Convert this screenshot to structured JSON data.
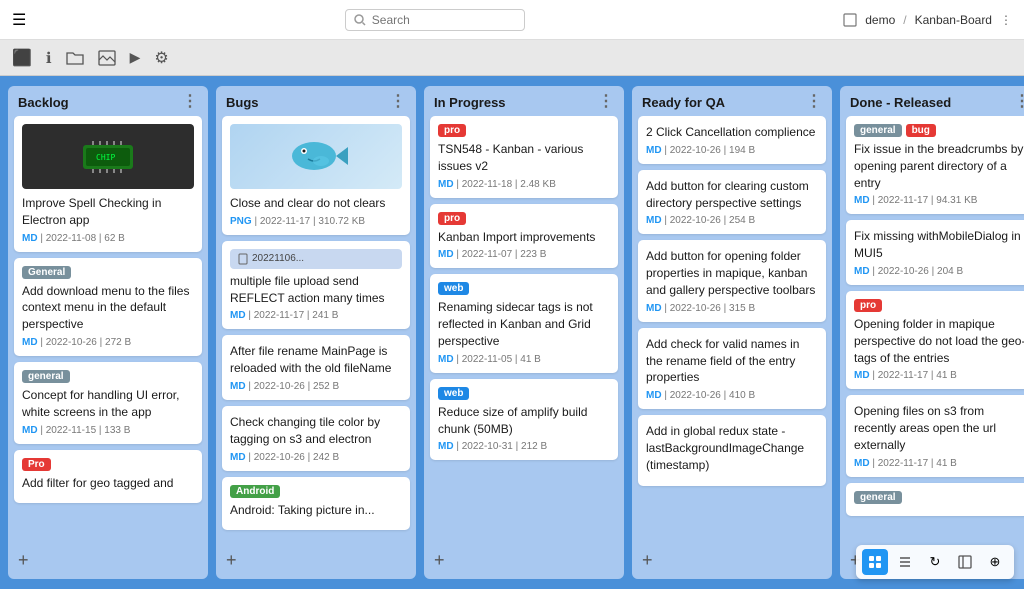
{
  "topNav": {
    "searchPlaceholder": "Search",
    "breadcrumb": [
      "demo",
      "Kanban-Board"
    ],
    "menuLabel": "☰"
  },
  "secondNav": {
    "icons": [
      "exit",
      "info",
      "folder",
      "image",
      "play",
      "gear"
    ]
  },
  "columns": [
    {
      "id": "backlog",
      "title": "Backlog",
      "cards": [
        {
          "id": "b1",
          "hasImage": true,
          "imageType": "chip",
          "title": "Improve Spell Checking in Electron app",
          "meta": "MD | 2022-11-08 | 62 B",
          "tags": []
        },
        {
          "id": "b2",
          "hasImage": false,
          "title": "Add download menu to the files context menu in the default perspective",
          "meta": "MD | 2022-10-26 | 272 B",
          "tags": [
            {
              "label": "General",
              "type": "general"
            }
          ]
        },
        {
          "id": "b3",
          "hasImage": false,
          "title": "Concept for handling UI error, white screens in the app",
          "meta": "MD | 2022-11-15 | 133 B",
          "tags": [
            {
              "label": "general",
              "type": "general"
            }
          ]
        },
        {
          "id": "b4",
          "hasImage": false,
          "title": "Add filter for geo tagged and",
          "meta": "",
          "tags": [
            {
              "label": "Pro",
              "type": "pro"
            }
          ]
        }
      ]
    },
    {
      "id": "bugs",
      "title": "Bugs",
      "cards": [
        {
          "id": "bug1",
          "hasImage": true,
          "imageType": "fish",
          "title": "Close and clear do not clears",
          "meta": "PNG | 2022-11-17 | 310.72 KB",
          "tags": []
        },
        {
          "id": "bug2",
          "hasImage": false,
          "hasFileRef": true,
          "fileRef": "20221106...",
          "title": "multiple file upload send REFLECT action many times",
          "meta": "MD | 2022-11-17 | 241 B",
          "tags": []
        },
        {
          "id": "bug3",
          "hasImage": false,
          "title": "After file rename MainPage is reloaded with the old fileName",
          "meta": "MD | 2022-10-26 | 252 B",
          "tags": []
        },
        {
          "id": "bug4",
          "hasImage": false,
          "title": "Check changing tile color by tagging on s3 and electron",
          "meta": "MD | 2022-10-26 | 242 B",
          "tags": []
        },
        {
          "id": "bug5",
          "hasImage": false,
          "title": "Android: Taking picture in...",
          "meta": "",
          "tags": [
            {
              "label": "Android",
              "type": "android"
            }
          ]
        }
      ]
    },
    {
      "id": "inprogress",
      "title": "In Progress",
      "cards": [
        {
          "id": "ip1",
          "hasImage": false,
          "title": "TSN548 - Kanban - various issues v2",
          "meta": "MD | 2022-11-18 | 2.48 KB",
          "tags": [
            {
              "label": "pro",
              "type": "pro"
            }
          ]
        },
        {
          "id": "ip2",
          "hasImage": false,
          "title": "Kanban Import improvements",
          "meta": "MD | 2022-11-07 | 223 B",
          "tags": [
            {
              "label": "pro",
              "type": "pro"
            }
          ]
        },
        {
          "id": "ip3",
          "hasImage": false,
          "title": "Renaming sidecar tags is not reflected in Kanban and Grid perspective",
          "meta": "MD | 2022-11-05 | 41 B",
          "tags": [
            {
              "label": "web",
              "type": "web"
            }
          ]
        },
        {
          "id": "ip4",
          "hasImage": false,
          "title": "Reduce size of amplify build chunk (50MB)",
          "meta": "MD | 2022-10-31 | 212 B",
          "tags": [
            {
              "label": "web",
              "type": "web"
            }
          ]
        }
      ]
    },
    {
      "id": "readyqa",
      "title": "Ready for QA",
      "cards": [
        {
          "id": "qa1",
          "hasImage": false,
          "title": "2 Click Cancellation complience",
          "meta": "MD | 2022-10-26 | 194 B",
          "tags": []
        },
        {
          "id": "qa2",
          "hasImage": false,
          "title": "Add button for clearing custom directory perspective settings",
          "meta": "MD | 2022-10-26 | 254 B",
          "tags": []
        },
        {
          "id": "qa3",
          "hasImage": false,
          "title": "Add button for opening folder properties in mapique, kanban and gallery perspective toolbars",
          "meta": "MD | 2022-10-26 | 315 B",
          "tags": []
        },
        {
          "id": "qa4",
          "hasImage": false,
          "title": "Add check for valid names in the rename field of the entry properties",
          "meta": "MD | 2022-10-26 | 410 B",
          "tags": []
        },
        {
          "id": "qa5",
          "hasImage": false,
          "title": "Add in global redux state - lastBackgroundImageChange (timestamp)",
          "meta": "",
          "tags": []
        }
      ]
    },
    {
      "id": "done",
      "title": "Done - Released",
      "cards": [
        {
          "id": "d1",
          "hasImage": false,
          "title": "Fix issue in the breadcrumbs by opening parent directory of a entry",
          "meta": "MD | 2022-11-17 | 94.31 KB",
          "tags": [
            {
              "label": "general",
              "type": "general"
            },
            {
              "label": "bug",
              "type": "bug"
            }
          ]
        },
        {
          "id": "d2",
          "hasImage": false,
          "title": "Fix missing withMobileDialog in MUI5",
          "meta": "MD | 2022-10-26 | 204 B",
          "tags": []
        },
        {
          "id": "d3",
          "hasImage": false,
          "title": "Opening folder in mapique perspective do not load the geo-tags of the entries",
          "meta": "MD | 2022-11-17 | 41 B",
          "tags": [
            {
              "label": "pro",
              "type": "pro"
            }
          ]
        },
        {
          "id": "d4",
          "hasImage": false,
          "title": "Opening files on s3 from recently areas open the url externally",
          "meta": "MD | 2022-11-17 | 41 B",
          "tags": []
        },
        {
          "id": "d5",
          "hasImage": false,
          "title": "",
          "meta": "",
          "tags": [
            {
              "label": "general",
              "type": "general"
            }
          ]
        }
      ]
    }
  ],
  "footer": {
    "icons": [
      "grid",
      "list",
      "refresh",
      "sidebar",
      "stack"
    ]
  },
  "addButtonLabel": "+"
}
